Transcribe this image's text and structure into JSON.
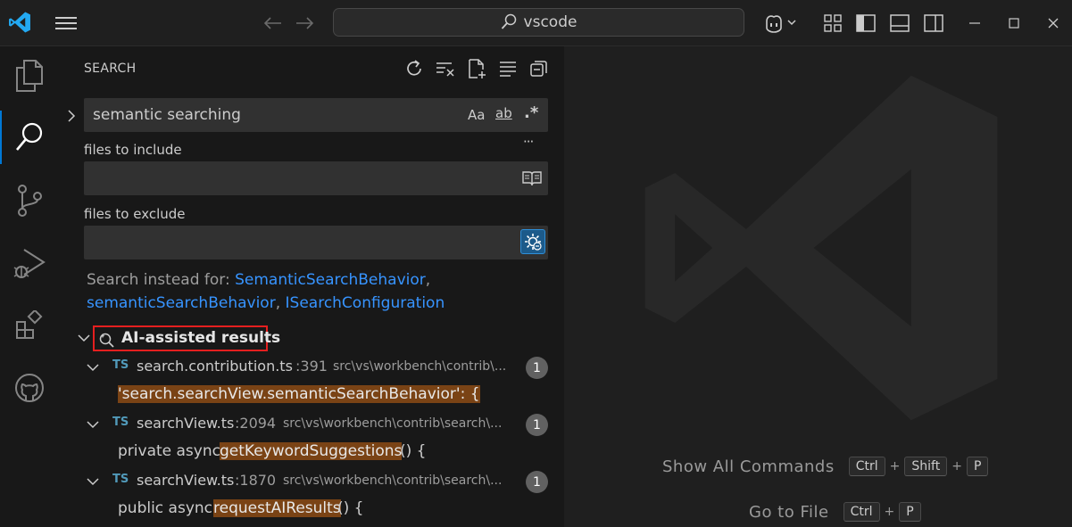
{
  "colors": {
    "accent": "#3794ff",
    "vscode_blue": "#23a9f2",
    "highlight": "#7a4315",
    "badge": "#616161",
    "red_box": "#e51f1f"
  },
  "titlebar": {
    "search_text": "vscode"
  },
  "activity_bar": {
    "items": [
      "explorer-icon",
      "search-icon",
      "source-control-icon",
      "run-debug-icon",
      "extensions-icon",
      "github-icon"
    ]
  },
  "search": {
    "title": "SEARCH",
    "query_value": "semantic searching",
    "match_case_label": "Aa",
    "whole_word_label": "ab",
    "regex_label": ".*",
    "more_label": "···",
    "files_include_label": "files to include",
    "files_include_value": "",
    "files_exclude_label": "files to exclude",
    "files_exclude_value": "",
    "suggest_prefix": "Search instead for:",
    "suggest_1": "SemanticSearchBehavior",
    "suggest_2": "semanticSearchBehavior",
    "suggest_3": "ISearchConfiguration",
    "sep_1": ",",
    "sep_2": ",",
    "ai_header": "AI-assisted results",
    "results": [
      {
        "lang": "TS",
        "file": "search.contribution.ts",
        "line": ":391",
        "path": "src\\vs\\workbench\\contrib\\...",
        "count": "1",
        "pre": "",
        "match": "'search.searchView.semanticSearchBehavior': {",
        "post": ""
      },
      {
        "lang": "TS",
        "file": "searchView.ts",
        "line": ":2094",
        "path": "src\\vs\\workbench\\contrib\\search\\...",
        "count": "1",
        "pre": "private async ",
        "match": "getKeywordSuggestions",
        "post": "() {"
      },
      {
        "lang": "TS",
        "file": "searchView.ts",
        "line": ":1870",
        "path": "src\\vs\\workbench\\contrib\\search\\...",
        "count": "1",
        "pre": "public async ",
        "match": "requestAIResults",
        "post": "() {"
      }
    ]
  },
  "editor": {
    "show_all_commands_label": "Show All Commands",
    "show_all_keys": [
      "Ctrl",
      "Shift",
      "P"
    ],
    "go_to_file_label": "Go to File",
    "go_to_file_keys": [
      "Ctrl",
      "P"
    ],
    "plus": "+"
  }
}
